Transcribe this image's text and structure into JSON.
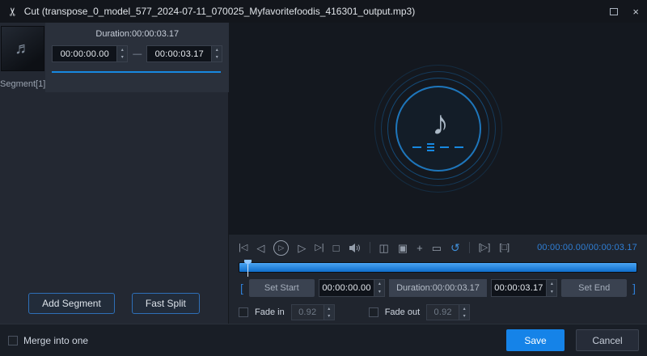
{
  "titlebar": {
    "title": "Cut (transpose_0_model_577_2024-07-11_070025_Myfavoritefoodis_416301_output.mp3)"
  },
  "icons": {
    "scissors": "✂",
    "close": "×",
    "music_note_small": "♬",
    "music_note_large": "♪",
    "chevron_up": "∧",
    "chevron_down": "∨",
    "spin_up": "▴",
    "spin_down": "▾",
    "go_start": "|◁",
    "step_back": "◁",
    "play": "▷",
    "step_forward": "▷",
    "go_end": "▷|",
    "stop": "□",
    "split": "◫",
    "mark": "▣",
    "add": "+",
    "copy": "▭",
    "reset": "↺",
    "play_segment": "[▷]",
    "stop_segment": "[□]",
    "bracket_left": "[",
    "bracket_right": "]",
    "range_separator": "—"
  },
  "segments": {
    "duration_label": "Duration:00:00:03.17",
    "start": "00:00:00.00",
    "end": "00:00:03.17",
    "items": [
      {
        "label": "Segment[1]"
      }
    ],
    "add_segment_label": "Add Segment",
    "fast_split_label": "Fast Split"
  },
  "player": {
    "time_display": "00:00:00.00/00:00:03.17",
    "set_start_label": "Set Start",
    "start_value": "00:00:00.00",
    "duration_label": "Duration:00:00:03.17",
    "end_value": "00:00:03.17",
    "set_end_label": "Set End",
    "fade_in_label": "Fade in",
    "fade_in_value": "0.92",
    "fade_out_label": "Fade out",
    "fade_out_value": "0.92"
  },
  "footer": {
    "merge_label": "Merge into one",
    "save_label": "Save",
    "cancel_label": "Cancel"
  },
  "colors": {
    "accent": "#1788e0",
    "save_button": "#1583e8",
    "time_text": "#2f7fd6"
  }
}
